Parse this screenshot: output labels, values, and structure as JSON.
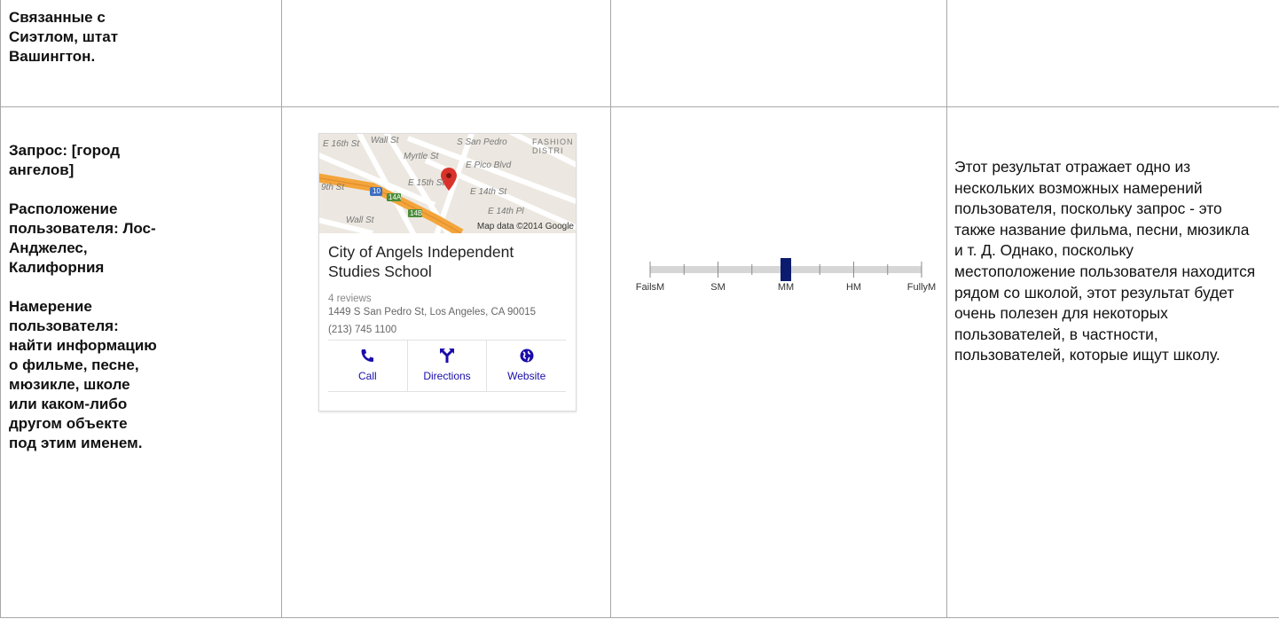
{
  "row1": {
    "heading": "Связанные с Сиэтлом, штат Вашингтон."
  },
  "row2": {
    "query": "Запрос: [город ангелов]",
    "location": "Расположение пользователя: Лос-Анджелес, Калифорния",
    "intent": "Намерение пользователя: найти информацию о фильме, песне, мюзикле, школе или каком-либо другом объекте под этим именем.",
    "card": {
      "map_labels": [
        "E 16th St",
        "Wall St",
        "Myrtle St",
        "S San Pedro",
        "E Pico Blvd",
        "E 15th St",
        "9th St",
        "E 14th St",
        "E 14th Pl",
        "Wall St",
        "FASHION DISTRI",
        "10",
        "14A",
        "14B"
      ],
      "map_attribution": "Map data ©2014 Google",
      "title": "City of Angels Independent Studies School",
      "reviews": "4 reviews",
      "address": "1449 S San Pedro St, Los Angeles, CA 90015",
      "phone": "(213) 745 1100",
      "actions": [
        {
          "label": "Call",
          "icon": "phone-icon"
        },
        {
          "label": "Directions",
          "icon": "directions-icon"
        },
        {
          "label": "Website",
          "icon": "globe-icon"
        }
      ],
      "colors": {
        "link": "#1a0dab",
        "highway": "#f3a53b",
        "pin": "#d9322b"
      }
    },
    "rating": {
      "ticks": [
        "FailsM",
        "SM",
        "MM",
        "HM",
        "FullyM"
      ],
      "selected": "MM",
      "selected_fraction": 0.5,
      "marker_color": "#0b1c6e"
    },
    "explanation": "Этот результат отражает одно из нескольких возможных намерений пользователя, поскольку запрос - это также название фильма, песни, мюзикла и т. Д. Однако, поскольку местоположение пользователя находится рядом со школой, этот результат будет очень полезен для некоторых пользователей, в частности, пользователей, которые ищут школу."
  }
}
